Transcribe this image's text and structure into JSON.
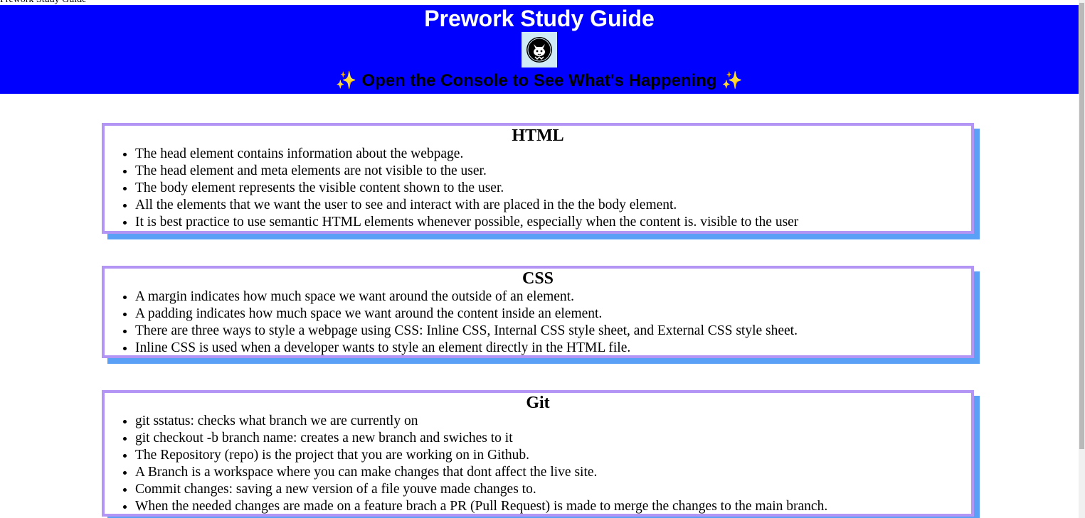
{
  "page": {
    "tab_title": "Prework Study Guide"
  },
  "header": {
    "title": "Prework Study Guide",
    "tagline": "Open the Console to See What's Happening",
    "sparkle": "✨",
    "logo_icon": "cat-face-icon",
    "background_color": "#0000ff"
  },
  "sections": [
    {
      "title": "HTML",
      "items": [
        "The head element contains information about the webpage.",
        "The head element and meta elements are not visible to the user.",
        "The body element represents the visible content shown to the user.",
        "All the elements that we want the user to see and interact with are placed in the the body element.",
        "It is best practice to use semantic HTML elements whenever possible, especially when the content is. visible to the user"
      ]
    },
    {
      "title": "CSS",
      "items": [
        "A margin indicates how much space we want around the outside of an element.",
        "A padding indicates how much space we want around the content inside an element.",
        "There are three ways to style a webpage using CSS: Inline CSS, Internal CSS style sheet, and External CSS style sheet.",
        "Inline CSS is used when a developer wants to style an element directly in the HTML file."
      ]
    },
    {
      "title": "Git",
      "items": [
        "git sstatus: checks what branch we are currently on",
        "git checkout -b branch name: creates a new branch and swiches to it",
        "The Repository (repo) is the project that you are working on in Github.",
        "A Branch is a workspace where you can make changes that dont affect the live site.",
        "Commit changes: saving a new version of a file youve made changes to.",
        "When the needed changes are made on a feature brach a PR (Pull Request) is made to merge the changes to the main branch."
      ]
    }
  ],
  "colors": {
    "card_border": "#b295f5",
    "card_shadow": "#5aa0f7"
  }
}
